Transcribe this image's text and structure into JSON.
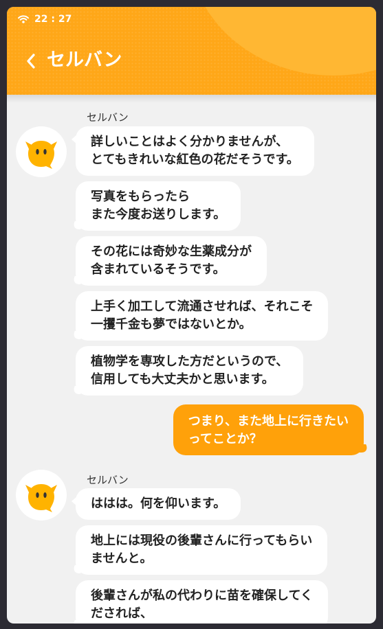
{
  "status_bar": {
    "time": "22 : 27"
  },
  "header": {
    "title": "セルバン"
  },
  "messages": [
    {
      "sender": "セルバン"
    },
    {
      "text": "詳しいことはよく分かりませんが、\nとてもきれいな紅色の花だそうです。"
    },
    {
      "text": "写真をもらったら\nまた今度お送りします。"
    },
    {
      "text": "その花には奇妙な生薬成分が\n含まれているそうです。"
    },
    {
      "text": "上手く加工して流通させれば、それこそ\n一攫千金も夢ではないとか。"
    },
    {
      "text": "植物学を専攻した方だというので、\n信用しても大丈夫かと思います。"
    },
    {
      "text": "つまり、また地上に行きたい\nってことか？"
    },
    {
      "sender": "セルバン"
    },
    {
      "text": "ははは。何を仰います。"
    },
    {
      "text": "地上には現役の後輩さんに行ってもらい\nませんと。"
    },
    {
      "text": "後輩さんが私の代わりに苗を確保してく\nだされば、"
    }
  ],
  "colors": {
    "header": "#ffa718",
    "my_bubble": "#ffa10a",
    "other_bubble": "#ffffff",
    "chat_background": "#f1f1f1"
  }
}
